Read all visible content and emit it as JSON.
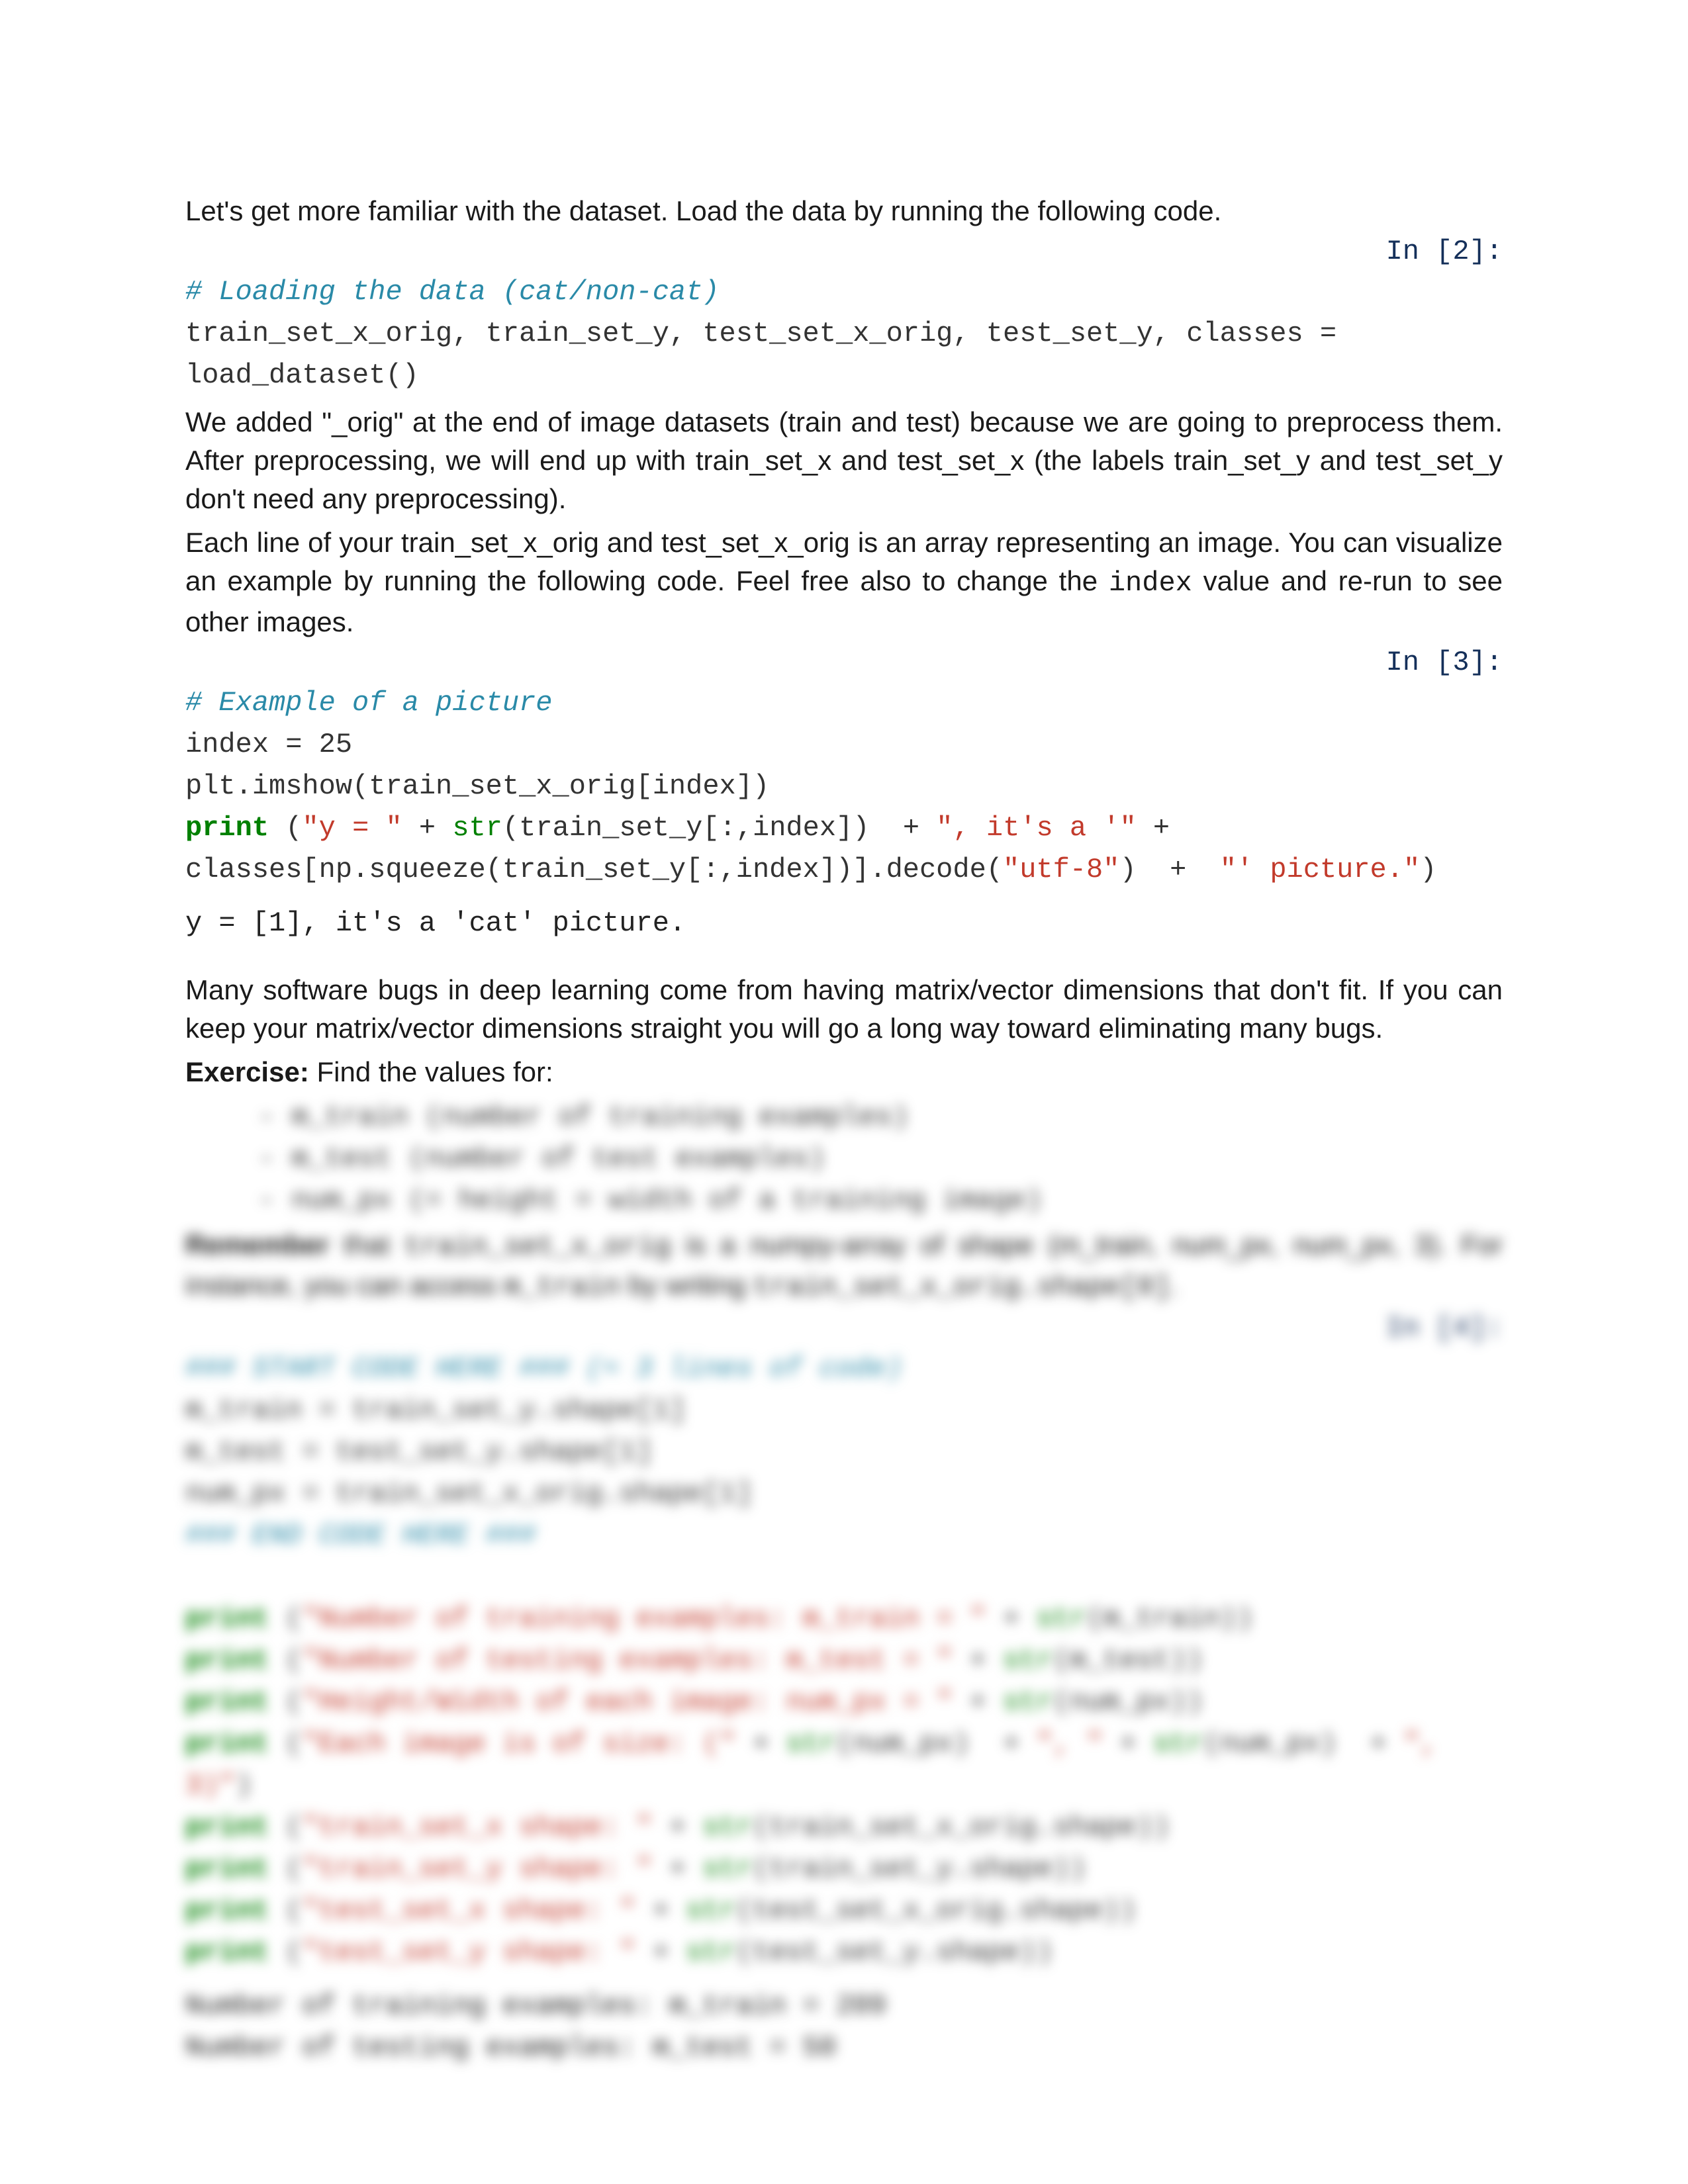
{
  "p1": "Let's get more familiar with the dataset. Load the data by running the following code.",
  "in2": "In [2]:",
  "code2_comment": "# Loading the data (cat/non-cat)",
  "code2_line1a": "train_set_x_orig, train_set_y, test_set_x_orig, test_set_y, classes ",
  "op_eq": "=",
  "code2_line2": "load_dataset()",
  "p2a": "We added \"_orig\" at the end of image datasets (train and test) because we are going to preprocess them. After preprocessing, we will end up with train_set_x and test_set_x (the labels train_set_y and test_set_y don't need any preprocessing).",
  "p2b_a": "Each line of your train_set_x_orig and test_set_x_orig is an array representing an image. You can visualize an example by running the following code. Feel free also to change the ",
  "p2b_idx": "index",
  "p2b_c": " value and re-run to see other images.",
  "in3": "In [3]:",
  "code3_comment": "# Example of a picture",
  "code3_l1_a": "index ",
  "code3_l1_b": " 25",
  "code3_l2": "plt.imshow(train_set_x_orig[index])",
  "kw_print": "print",
  "fn_str": "str",
  "code3_l3_a": " (",
  "code3_l3_s1": "\"y = \"",
  "code3_l3_plus": " + ",
  "code3_l3_b": "(train_set_y[:,index]) ",
  "code3_l3_s2": "\", it's a '\"",
  "code3_l4_a": "classes[np.squeeze(train_set_y[:,index])].decode(",
  "code3_l4_s1": "\"utf-8\"",
  "code3_l4_b": ") ",
  "code3_l4_s2": " \"' picture.\"",
  "code3_l4_c": ")",
  "out3": "y = [1], it's a 'cat' picture.",
  "p3": "Many software bugs in deep learning come from having matrix/vector dimensions that don't fit. If you can keep your matrix/vector dimensions straight you will go a long way toward eliminating many bugs.",
  "p4_bold": "Exercise:",
  "p4_rest": " Find the values for:",
  "bullet1": "- m_train (number of training examples)",
  "bullet2": "- m_test (number of test examples)",
  "bullet3": "- num_px (= height = width of a training image)",
  "remember_bold": "Remember",
  "remember_a": " that ",
  "remember_code1": "train_set_x_orig",
  "remember_b": " is a numpy-array of shape (m_train, num_px, num_px, 3). For instance, you can access ",
  "remember_code2": "m_train",
  "remember_c": " by writing ",
  "remember_code3": "train_set_x_orig.shape[0]",
  "remember_d": ".",
  "in4": "In [4]:",
  "code4_c1": "### START CODE HERE ### (≈ 3 lines of code)",
  "code4_l1_a": "m_train ",
  "code4_l1_b": " train_set_y.shape[1]",
  "code4_l2_a": "m_test ",
  "code4_l2_b": " test_set_y.shape[1]",
  "code4_l3_a": "num_px ",
  "code4_l3_b": " train_set_x_orig.shape[1]",
  "code4_c2": "### END CODE HERE ###",
  "p_open": " (",
  "p_close": ")",
  "p_plus": " + ",
  "pr1_s": "\"Number of training examples: m_train = \"",
  "pr1_v": "(m_train))",
  "pr2_s": "\"Number of testing examples: m_test = \"",
  "pr2_v": "(m_test))",
  "pr3_s": "\"Height/Width of each image: num_px = \"",
  "pr3_v": "(num_px))",
  "pr4_s": "\"Each image is of size: (\"",
  "pr4_v1": "(num_px) ",
  "pr4_s2": "\", \"",
  "pr4_v2": "(num_px) ",
  "pr4_s3": "\", 3)\"",
  "pr5_s": "\"train_set_x shape: \"",
  "pr5_v": "(train_set_x_orig.shape))",
  "pr6_s": "\"train_set_y shape: \"",
  "pr6_v": "(train_set_y.shape))",
  "pr7_s": "\"test_set_x shape: \"",
  "pr7_v": "(test_set_x_orig.shape))",
  "pr8_s": "\"test_set_y shape: \"",
  "pr8_v": "(test_set_y.shape))",
  "out4_l1": "Number of training examples: m_train = 209",
  "out4_l2": "Number of testing examples: m_test = 50"
}
